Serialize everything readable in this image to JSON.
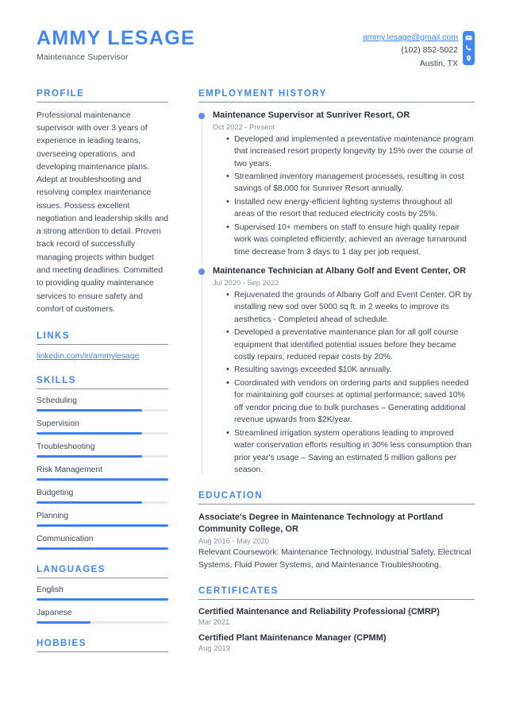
{
  "header": {
    "name": "AMMY LESAGE",
    "job_title": "Maintenance Supervisor",
    "contact": {
      "email": "ammy.lesage@gmail.com",
      "phone": "(102) 852-5022",
      "location": "Austin, TX",
      "icons": [
        "envelope-icon",
        "phone-icon",
        "location-pin-icon"
      ]
    }
  },
  "colors": {
    "accent": "#4285f4",
    "bar_fill": "#3b7ff0",
    "bar_track": "#e9eaec",
    "heading_rule": "#8a9099",
    "text": "#3d4654",
    "muted": "#8a9099"
  },
  "left": {
    "profile": {
      "title": "PROFILE",
      "text": "Professional maintenance supervisor with over 3 years of experience in leading teams, overseeing operations, and developing maintenance plans. Adept at troubleshooting and resolving complex maintenance issues. Possess excellent negotiation and leadership skills and a strong attention to detail. Proven track record of successfully managing projects within budget and meeting deadlines. Committed to providing quality maintenance services to ensure safety and comfort of customers."
    },
    "links": {
      "title": "LINKS",
      "items": [
        {
          "label": "linkedin.com/in/ammylesage"
        }
      ]
    },
    "skills": {
      "title": "SKILLS",
      "items": [
        {
          "label": "Scheduling",
          "level": 80
        },
        {
          "label": "Supervision",
          "level": 80
        },
        {
          "label": "Troubleshooting",
          "level": 80
        },
        {
          "label": "Risk Management",
          "level": 100
        },
        {
          "label": "Budgeting",
          "level": 80
        },
        {
          "label": "Planning",
          "level": 100
        },
        {
          "label": "Communication",
          "level": 100
        }
      ]
    },
    "languages": {
      "title": "LANGUAGES",
      "items": [
        {
          "label": "English",
          "level": 100
        },
        {
          "label": "Japanese",
          "level": 41
        }
      ]
    },
    "hobbies": {
      "title": "HOBBIES",
      "items": []
    }
  },
  "right": {
    "employment": {
      "title": "EMPLOYMENT HISTORY",
      "jobs": [
        {
          "heading": "Maintenance Supervisor at Sunriver Resort, OR",
          "date": "Oct 2022 - Present",
          "bullets": [
            "Developed and implemented a preventative maintenance program that increased resort property longevity by 15% over the course of two years.",
            "Streamlined inventory management processes, resulting in cost savings of $8,000 for Sunriver Resort annually.",
            "Installed new energy-efficient lighting systems throughout all areas of the resort that reduced electricity costs by 25%.",
            "Supervised 10+ members on staff to ensure high quality repair work was completed efficiently; achieved an average turnaround time decrease from 3 days to 1 day per job request."
          ]
        },
        {
          "heading": "Maintenance Technician at Albany Golf and Event Center, OR",
          "date": "Jul 2020 - Sep 2022",
          "bullets": [
            "Rejuvenated the grounds of Albany Golf and Event Center, OR by installing new sod over 5000 sq ft. in 2 weeks to improve its aesthetics - Completed ahead of schedule.",
            "Developed a preventative maintenance plan for all golf course equipment that identified potential issues before they became costly repairs; reduced repair costs by 20%.",
            "Resulting savings exceeded $10K annually.",
            "Coordinated with vendors on ordering parts and supplies needed for maintaining golf courses at optimal performance; saved 10% off vendor pricing due to bulk purchases – Generating additional revenue upwards from $2K/year.",
            "Streamlined irrigation system operations leading to improved water conservation efforts resulting in 30% less consumption than prior year's usage – Saving an estimated 5 million gallons per season."
          ]
        }
      ]
    },
    "education": {
      "title": "EDUCATION",
      "items": [
        {
          "heading": "Associate's Degree in Maintenance Technology at Portland Community College, OR",
          "date": "Aug 2016 - May 2020",
          "description": "Relevant Coursework: Maintenance Technology, Industrial Safety, Electrical Systems, Fluid Power Systems, and Maintenance Troubleshooting."
        }
      ]
    },
    "certificates": {
      "title": "CERTIFICATES",
      "items": [
        {
          "name": "Certified Maintenance and Reliability Professional (CMRP)",
          "date": "Mar 2021"
        },
        {
          "name": "Certified Plant Maintenance Manager (CPMM)",
          "date": "Aug 2019"
        }
      ]
    }
  }
}
